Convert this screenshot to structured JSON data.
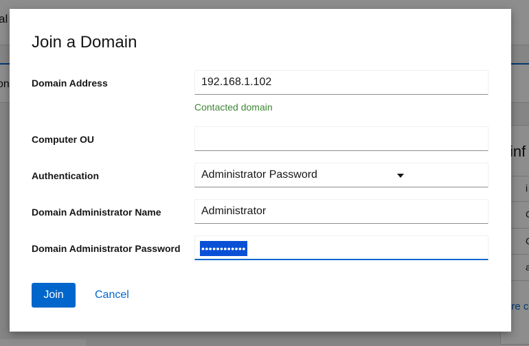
{
  "background": {
    "header_text": "al",
    "nav_text": "on",
    "card_title": "inf",
    "rows": [
      "i",
      "C",
      "C",
      "a"
    ],
    "link_text": "are c"
  },
  "dialog": {
    "title": "Join a Domain",
    "domain_address": {
      "label": "Domain Address",
      "value": "192.168.1.102",
      "helper": "Contacted domain"
    },
    "computer_ou": {
      "label": "Computer OU",
      "value": ""
    },
    "authentication": {
      "label": "Authentication",
      "selected": "Administrator Password"
    },
    "admin_name": {
      "label": "Domain Administrator Name",
      "value": "Administrator"
    },
    "admin_password": {
      "label": "Domain Administrator Password",
      "masked": "••••••••••••"
    },
    "join_label": "Join",
    "cancel_label": "Cancel"
  },
  "colors": {
    "accent": "#0066cc",
    "success": "#3e8635",
    "selection": "#0a50d6"
  }
}
